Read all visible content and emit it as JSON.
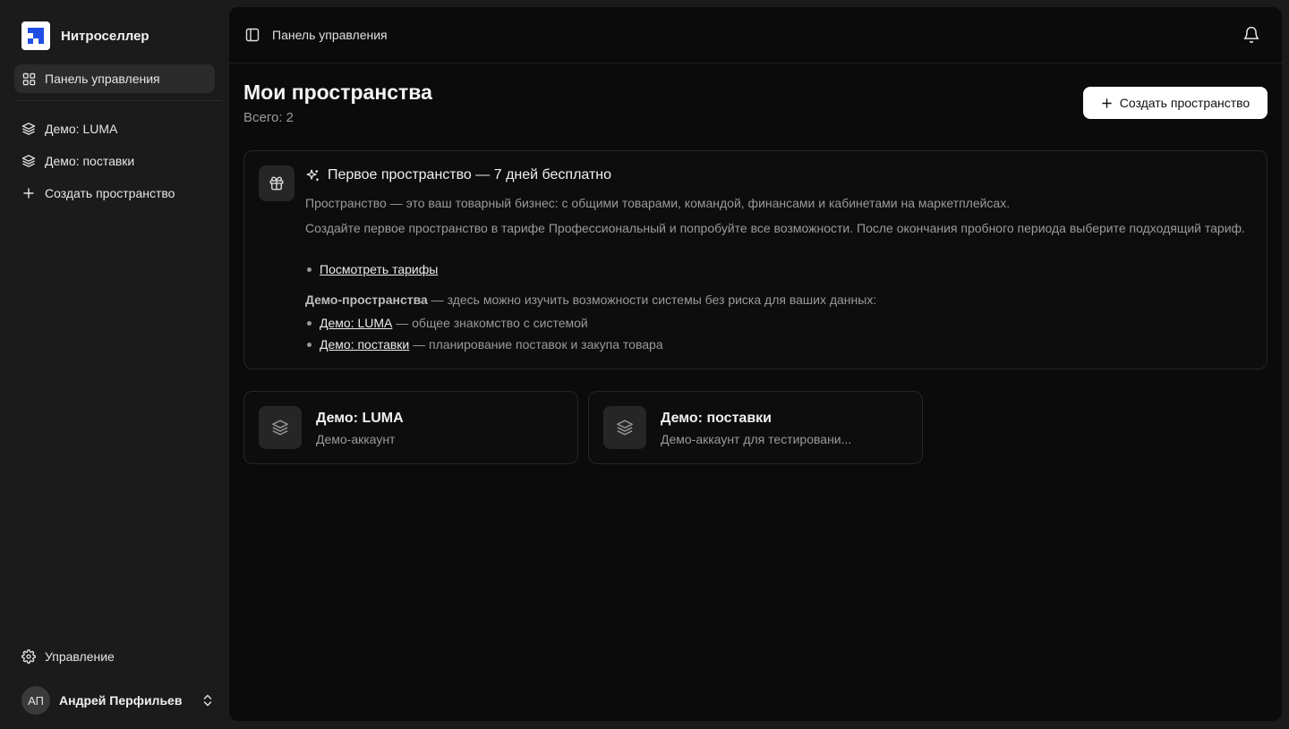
{
  "brand": {
    "name": "Нитроселлер"
  },
  "sidebar": {
    "dashboard_label": "Панель управления",
    "spaces": [
      {
        "label": "Демо: LUMA"
      },
      {
        "label": "Демо: поставки"
      }
    ],
    "create_label": "Создать пространство",
    "settings_label": "Управление",
    "user": {
      "initials": "АП",
      "name": "Андрей Перфильев"
    }
  },
  "topbar": {
    "title": "Панель управления"
  },
  "main": {
    "title": "Мои пространства",
    "count": "Всего: 2",
    "create_button": "Создать пространство"
  },
  "info": {
    "title": "Первое пространство — 7 дней бесплатно",
    "p1": "Пространство — это ваш товарный бизнес: с общими товарами, командой, финансами и кабинетами на маркетплейсах.",
    "p2": "Создайте первое пространство в тарифе Профессиональный и попробуйте все возможности. После окончания пробного периода выберите подходящий тариф.",
    "tariffs_link": "Посмотреть тарифы",
    "demo_strong": "Демо-пространства",
    "demo_rest": " — здесь можно изучить возможности системы без риска для ваших данных:",
    "demo_items": [
      {
        "link": "Демо: LUMA",
        "desc": " — общее знакомство с системой"
      },
      {
        "link": "Демо: поставки",
        "desc": " — планирование поставок и закупа товара"
      }
    ]
  },
  "cards": [
    {
      "name": "Демо: LUMA",
      "sub": "Демо-аккаунт"
    },
    {
      "name": "Демо: поставки",
      "sub": "Демо-аккаунт для тестировани..."
    }
  ],
  "colors": {
    "background": "#1b1b1b",
    "panel": "#0b0b0b",
    "accent": "#1f4ee6"
  }
}
